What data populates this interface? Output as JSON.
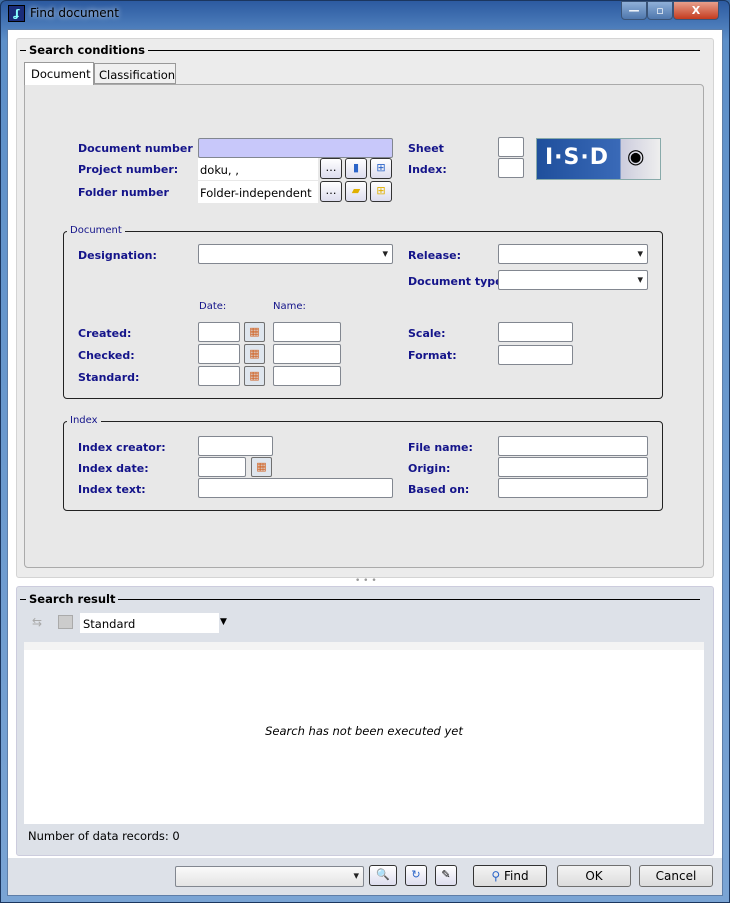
{
  "window": {
    "title": "Find document",
    "minimize": "—",
    "maximize": "▫",
    "close": "X"
  },
  "search_conditions": {
    "title": "Search conditions",
    "tabs": [
      {
        "label": "Document",
        "active": true
      },
      {
        "label": "Classification",
        "active": false
      }
    ],
    "document_number_label": "Document number",
    "document_number_value": "",
    "project_number_label": "Project number:",
    "project_number_value": "doku, ,",
    "folder_number_label": "Folder number",
    "folder_number_value": "Folder-independent",
    "sheet_label": "Sheet",
    "index_label": "Index:",
    "logo_text": "I·S·D",
    "document_group": {
      "title": "Document",
      "designation_label": "Designation:",
      "release_label": "Release:",
      "document_type_label": "Document type:",
      "date_header": "Date:",
      "name_header": "Name:",
      "created_label": "Created:",
      "checked_label": "Checked:",
      "standard_label": "Standard:",
      "scale_label": "Scale:",
      "format_label": "Format:"
    },
    "index_group": {
      "title": "Index",
      "index_creator_label": "Index creator:",
      "index_date_label": "Index date:",
      "index_text_label": "Index text:",
      "file_name_label": "File name:",
      "origin_label": "Origin:",
      "based_on_label": "Based on:"
    }
  },
  "search_result": {
    "title": "Search result",
    "view_select": "Standard",
    "empty_message": "Search has not been executed yet",
    "record_count": "Number of data records: 0"
  },
  "footer": {
    "find_label": "Find",
    "ok_label": "OK",
    "cancel_label": "Cancel",
    "query_select": ""
  }
}
